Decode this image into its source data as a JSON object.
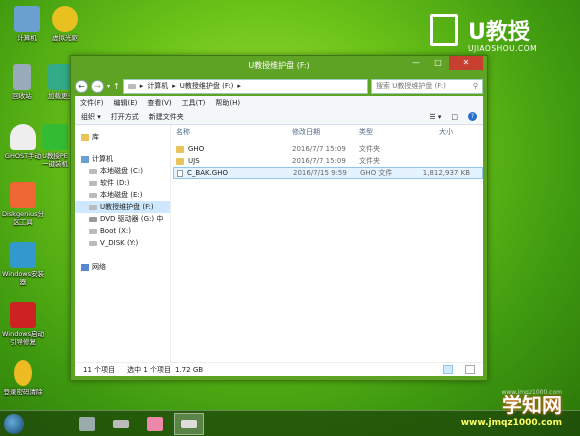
{
  "desktop": {
    "icons": [
      {
        "label": "计算机",
        "color": "#6aa0d0"
      },
      {
        "label": "虚拟光驱",
        "color": "#e8c020"
      },
      {
        "label": "回收站",
        "color": "#9ab"
      },
      {
        "label": "加载更多",
        "color": "#3a8"
      },
      {
        "label": "GHOST手动",
        "color": "#eee"
      },
      {
        "label": "U教授PE一键装机",
        "color": "#3b3"
      },
      {
        "label": "Diskgenius分区工具",
        "color": "#e63"
      },
      {
        "label": "Windows安装器",
        "color": "#39c"
      },
      {
        "label": "Windows启动引导修复",
        "color": "#c22"
      },
      {
        "label": "登录密码清除",
        "color": "#eb2"
      }
    ]
  },
  "brand": {
    "title": "U教授",
    "subtitle": "UJIAOSHOU.COM"
  },
  "window": {
    "title": "U教授维护盘 (F:)",
    "controls": {
      "minimize": "—",
      "maximize": "□",
      "close": "✕"
    },
    "address": {
      "path": [
        "计算机",
        "U教授维护盘 (F:)"
      ],
      "sep": "▸"
    },
    "search_placeholder": "搜索 U教授维护盘 (F:)",
    "menu": [
      "文件(F)",
      "编辑(E)",
      "查看(V)",
      "工具(T)",
      "帮助(H)"
    ],
    "toolbar": [
      "组织 ▾",
      "打开方式",
      "新建文件夹"
    ],
    "nav": {
      "library": "库",
      "computer": "计算机",
      "drives": [
        "本地磁盘 (C:)",
        "软件 (D:)",
        "本地磁盘 (E:)",
        "U教授维护盘 (F:)",
        "DVD 驱动器 (G:) 中",
        "Boot (X:)",
        "V_DISK (Y:)"
      ],
      "network": "网络",
      "selected_index": 3
    },
    "columns": {
      "name": "名称",
      "date": "修改日期",
      "type": "类型",
      "size": "大小"
    },
    "files": [
      {
        "name": "GHO",
        "date": "2016/7/7 15:09",
        "type": "文件夹",
        "size": "",
        "kind": "folder"
      },
      {
        "name": "UJS",
        "date": "2016/7/7 15:09",
        "type": "文件夹",
        "size": "",
        "kind": "folder"
      },
      {
        "name": "C_BAK.GHO",
        "date": "2016/7/15 9:59",
        "type": "GHO 文件",
        "size": "1,812,937 KB",
        "kind": "file"
      }
    ],
    "status": {
      "count": "11 个项目",
      "selected": "选中 1 个项目",
      "size": "1.72 GB"
    }
  },
  "watermark": {
    "main": "学知网",
    "url": "www.jmqz1000.com",
    "tiny": "www.jmqz1000.com"
  }
}
